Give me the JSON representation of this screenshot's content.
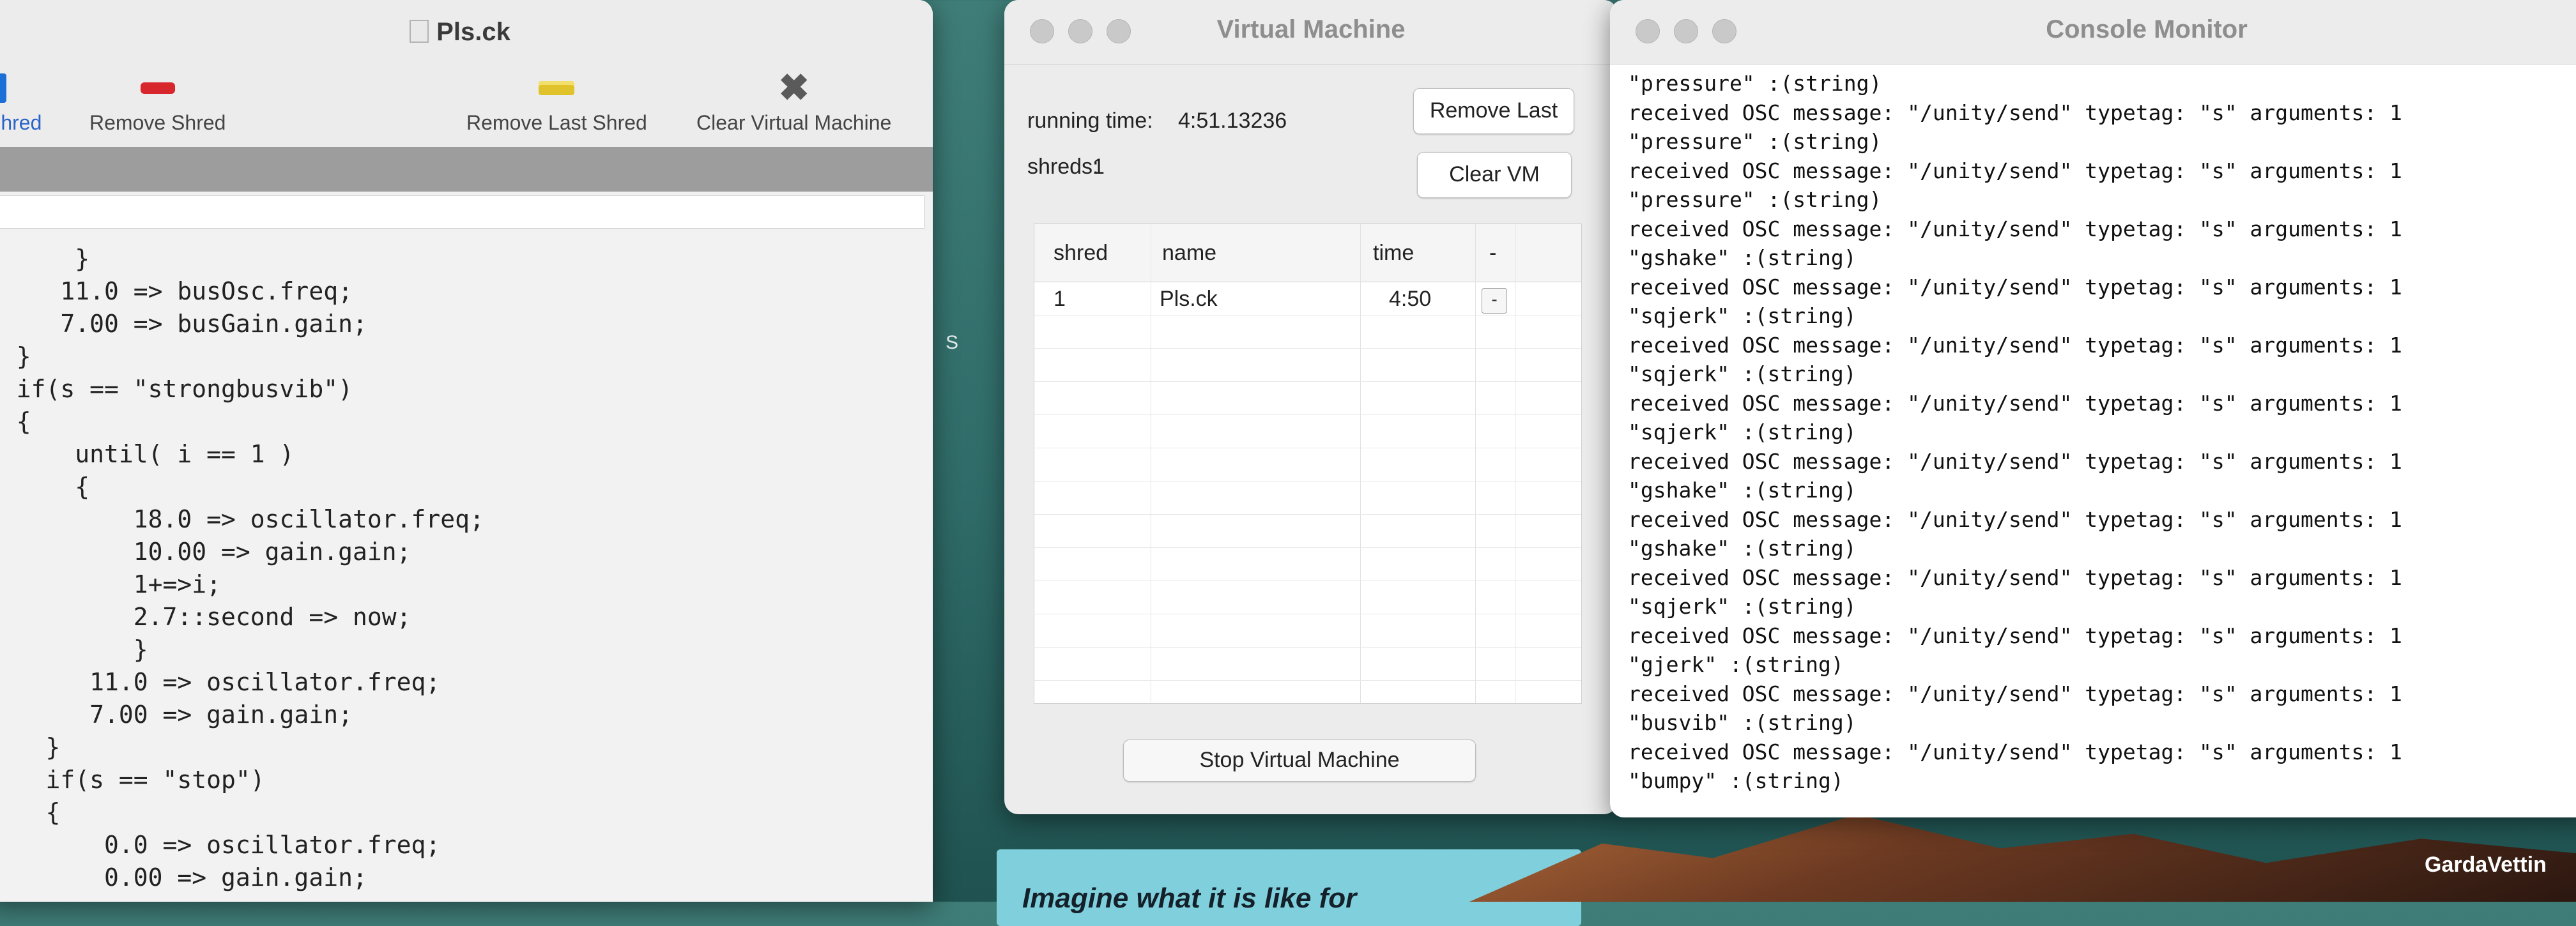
{
  "desktop": {
    "card_text": "Imagine what it is like for",
    "dock_label": "GardaVettin",
    "edge_glyph": "S"
  },
  "editor": {
    "title": "Pls.ck",
    "toolbar": {
      "add_shred_label": "Shred",
      "remove_shred_label": "Remove Shred",
      "remove_last_shred_label": "Remove Last Shred",
      "clear_vm_label": "Clear Virtual Machine"
    },
    "code_lines": [
      "      }",
      "     11.0 => busOsc.freq;",
      "     7.00 => busGain.gain;",
      "  }",
      "  if(s == \"strongbusvib\")",
      "  {",
      "      until( i == 1 )",
      "      {",
      "          18.0 => oscillator.freq;",
      "          10.00 => gain.gain;",
      "          1+=>i;",
      "          2.7::second => now;",
      "          }",
      "       11.0 => oscillator.freq;",
      "       7.00 => gain.gain;",
      "    }",
      "    if(s == \"stop\")",
      "    {",
      "        0.0 => oscillator.freq;",
      "        0.00 => gain.gain;"
    ]
  },
  "vm": {
    "title": "Virtual Machine",
    "running_time_label": "running time:",
    "running_time_value": "4:51.13236",
    "shreds_label": "shreds:",
    "shreds_value": "1",
    "remove_last_label": "Remove Last",
    "clear_vm_label": "Clear VM",
    "stop_label": "Stop Virtual Machine",
    "columns": [
      "shred",
      "name",
      "time",
      "-"
    ],
    "rows": [
      {
        "shred": "1",
        "name": "Pls.ck",
        "time": "4:50",
        "remove": "-"
      }
    ]
  },
  "console": {
    "title": "Console Monitor",
    "lines": [
      "\"pressure\" :(string)",
      "received OSC message: \"/unity/send\" typetag: \"s\" arguments: 1",
      "\"pressure\" :(string)",
      "received OSC message: \"/unity/send\" typetag: \"s\" arguments: 1",
      "\"pressure\" :(string)",
      "received OSC message: \"/unity/send\" typetag: \"s\" arguments: 1",
      "\"gshake\" :(string)",
      "received OSC message: \"/unity/send\" typetag: \"s\" arguments: 1",
      "\"sqjerk\" :(string)",
      "received OSC message: \"/unity/send\" typetag: \"s\" arguments: 1",
      "\"sqjerk\" :(string)",
      "received OSC message: \"/unity/send\" typetag: \"s\" arguments: 1",
      "\"sqjerk\" :(string)",
      "received OSC message: \"/unity/send\" typetag: \"s\" arguments: 1",
      "\"gshake\" :(string)",
      "received OSC message: \"/unity/send\" typetag: \"s\" arguments: 1",
      "\"gshake\" :(string)",
      "received OSC message: \"/unity/send\" typetag: \"s\" arguments: 1",
      "\"sqjerk\" :(string)",
      "received OSC message: \"/unity/send\" typetag: \"s\" arguments: 1",
      "\"gjerk\" :(string)",
      "received OSC message: \"/unity/send\" typetag: \"s\" arguments: 1",
      "\"busvib\" :(string)",
      "received OSC message: \"/unity/send\" typetag: \"s\" arguments: 1",
      "\"bumpy\" :(string)"
    ]
  }
}
